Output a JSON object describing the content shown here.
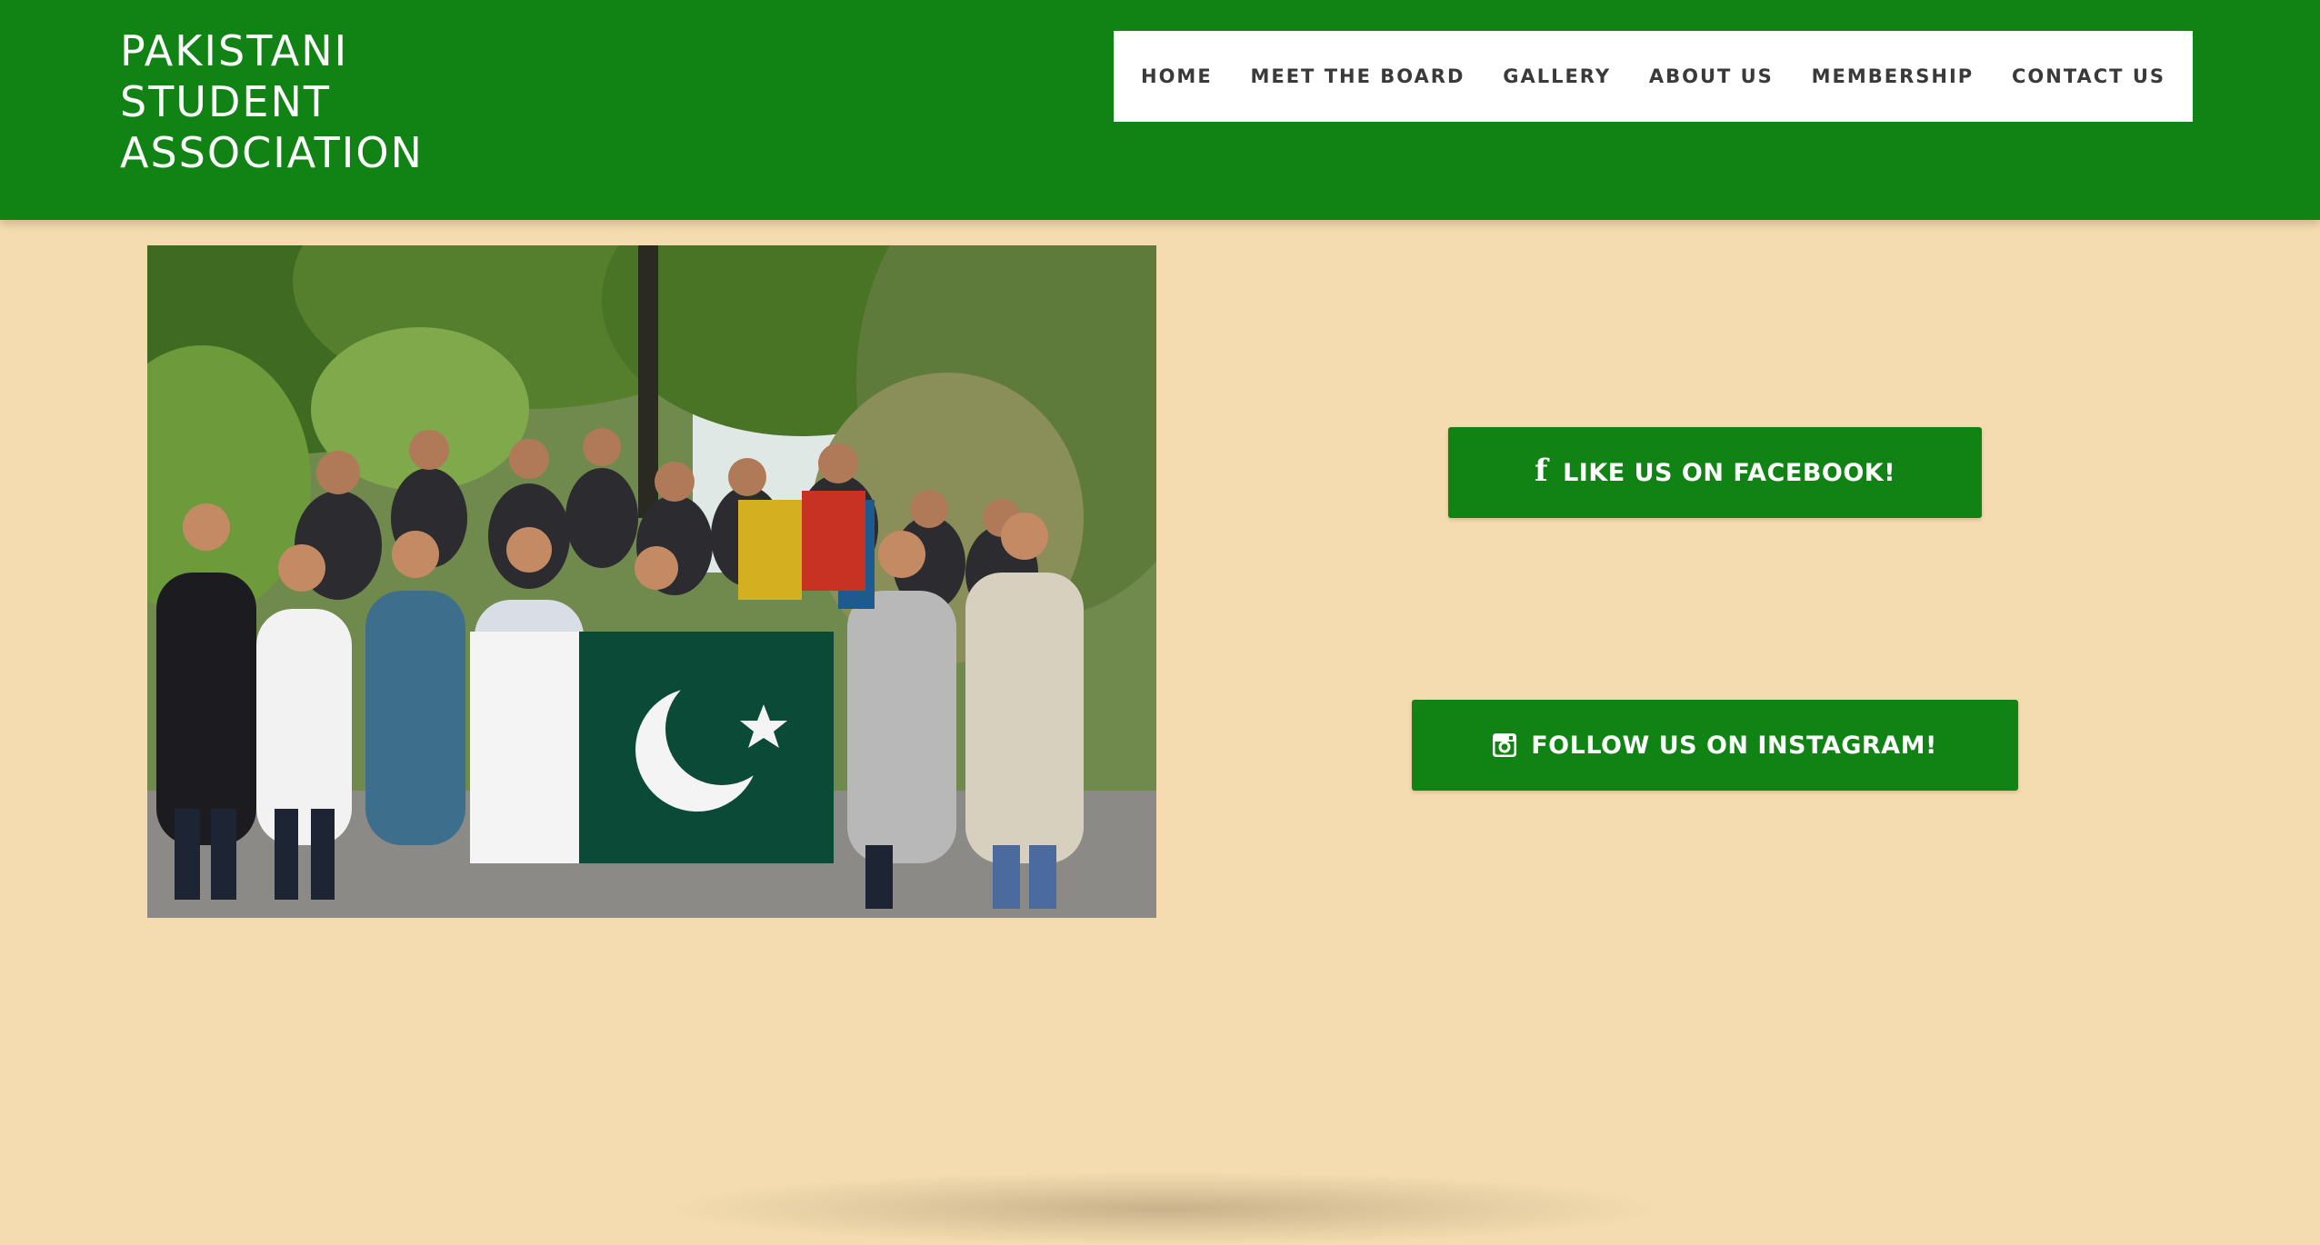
{
  "site": {
    "title": "PAKISTANI\nSTUDENT\nASSOCIATION"
  },
  "nav": {
    "items": [
      {
        "label": "HOME"
      },
      {
        "label": "MEET THE BOARD"
      },
      {
        "label": "GALLERY"
      },
      {
        "label": "ABOUT US"
      },
      {
        "label": "MEMBERSHIP"
      },
      {
        "label": "CONTACT US"
      }
    ]
  },
  "social": {
    "facebook_label": "LIKE US ON FACEBOOK!",
    "facebook_icon": "facebook-icon",
    "instagram_label": "FOLLOW US ON INSTAGRAM!",
    "instagram_icon": "instagram-icon"
  },
  "colors": {
    "brand_green": "#118214",
    "page_background": "#f4dcb0",
    "nav_background": "#ffffff",
    "nav_text": "#3a3a3a"
  }
}
